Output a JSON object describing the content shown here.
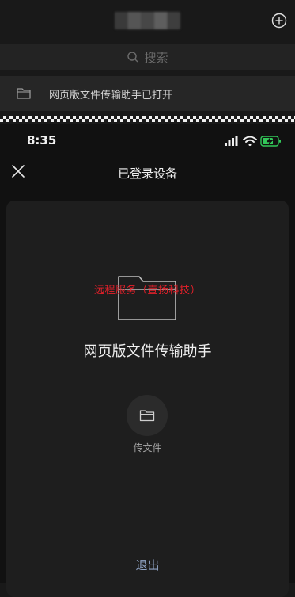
{
  "background_screen": {
    "search": {
      "placeholder": "搜索"
    },
    "file_row": {
      "label": "网页版文件传输助手已打开"
    }
  },
  "status_bar": {
    "time": "8:35"
  },
  "nav": {
    "title": "已登录设备"
  },
  "card": {
    "watermark": "远程服务（壹扬科技）",
    "device_name": "网页版文件传输助手",
    "transfer_label": "传文件",
    "logout_label": "退出"
  },
  "colors": {
    "background": "#191919",
    "sheet": "#111111",
    "card": "#1e1e1e",
    "watermark": "#e5202a",
    "logout": "#8fa3c4",
    "battery": "#33c759"
  },
  "icons": {
    "plus": "plus-circle-icon",
    "search": "search-icon",
    "folder": "folder-icon",
    "close": "close-icon",
    "signal": "signal-icon",
    "wifi": "wifi-icon",
    "battery": "battery-charging-icon"
  }
}
